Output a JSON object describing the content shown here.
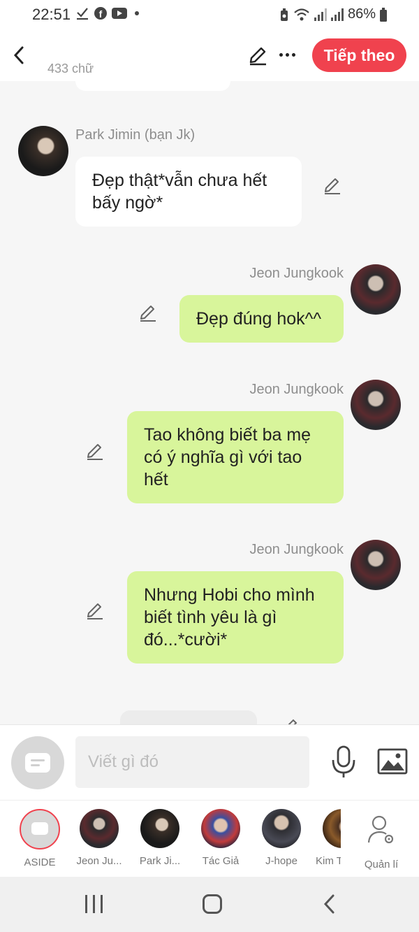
{
  "status_bar": {
    "time": "22:51",
    "battery": "86%",
    "icons": [
      "download-done-icon",
      "facebook-icon",
      "youtube-icon",
      "notification-dot-icon",
      "recycle-icon",
      "wifi-icon",
      "signal-icon",
      "signal-icon",
      "battery-icon"
    ]
  },
  "header": {
    "word_count": "433 chữ",
    "next_label": "Tiếp theo",
    "accent": "#f0424e"
  },
  "messages": [
    {
      "sender": "Park Jimin (bạn Jk)",
      "side": "left",
      "text": "Đẹp thật*vẫn chưa hết bấy ngờ*"
    },
    {
      "sender": "Jeon Jungkook",
      "side": "right",
      "text": "Đẹp đúng hok^^"
    },
    {
      "sender": "Jeon Jungkook",
      "side": "right",
      "text": "Tao không biết ba mẹ có ý nghĩa gì với tao hết"
    },
    {
      "sender": "Jeon Jungkook",
      "side": "right",
      "text": "Nhưng Hobi cho mình biết tình yêu là gì đó...*cười*"
    }
  ],
  "input": {
    "placeholder": "Viết gì đó"
  },
  "characters": [
    {
      "label": "ASIDE"
    },
    {
      "label": "Jeon Ju..."
    },
    {
      "label": "Park Ji..."
    },
    {
      "label": "Tác Giả"
    },
    {
      "label": "J-hope"
    },
    {
      "label": "Kim T"
    },
    {
      "label": "Quản lí"
    }
  ],
  "colors": {
    "right_bubble": "#d8f59b",
    "left_bubble": "#ffffff",
    "background": "#f6f6f6"
  }
}
